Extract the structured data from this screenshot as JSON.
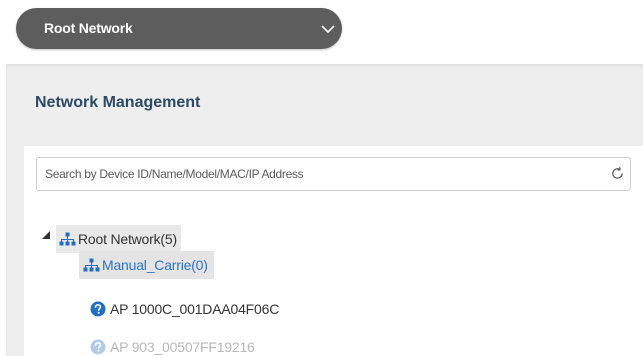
{
  "network_selector": {
    "label": "Root Network",
    "icon": "chevron-down-icon"
  },
  "panel": {
    "title": "Network Management"
  },
  "search": {
    "placeholder": "Search by Device ID/Name/Model/MAC/IP Address",
    "value": "",
    "refresh_icon": "refresh-icon"
  },
  "tree": {
    "root": {
      "label": "Root Network(5)",
      "icon": "network-icon",
      "expanded": true
    },
    "children": [
      {
        "label": "Manual_Carrie(0)",
        "icon": "network-icon",
        "selected": true
      },
      {
        "label": "AP 1000C_001DAA04F06C",
        "icon": "help-icon"
      },
      {
        "label": "AP 903_00507FF19216",
        "icon": "help-icon"
      }
    ]
  },
  "colors": {
    "selector_bg": "#5d5d5d",
    "title_color": "#2c4a66",
    "link_blue": "#2b74c7",
    "icon_blue": "#1f6fc5"
  }
}
